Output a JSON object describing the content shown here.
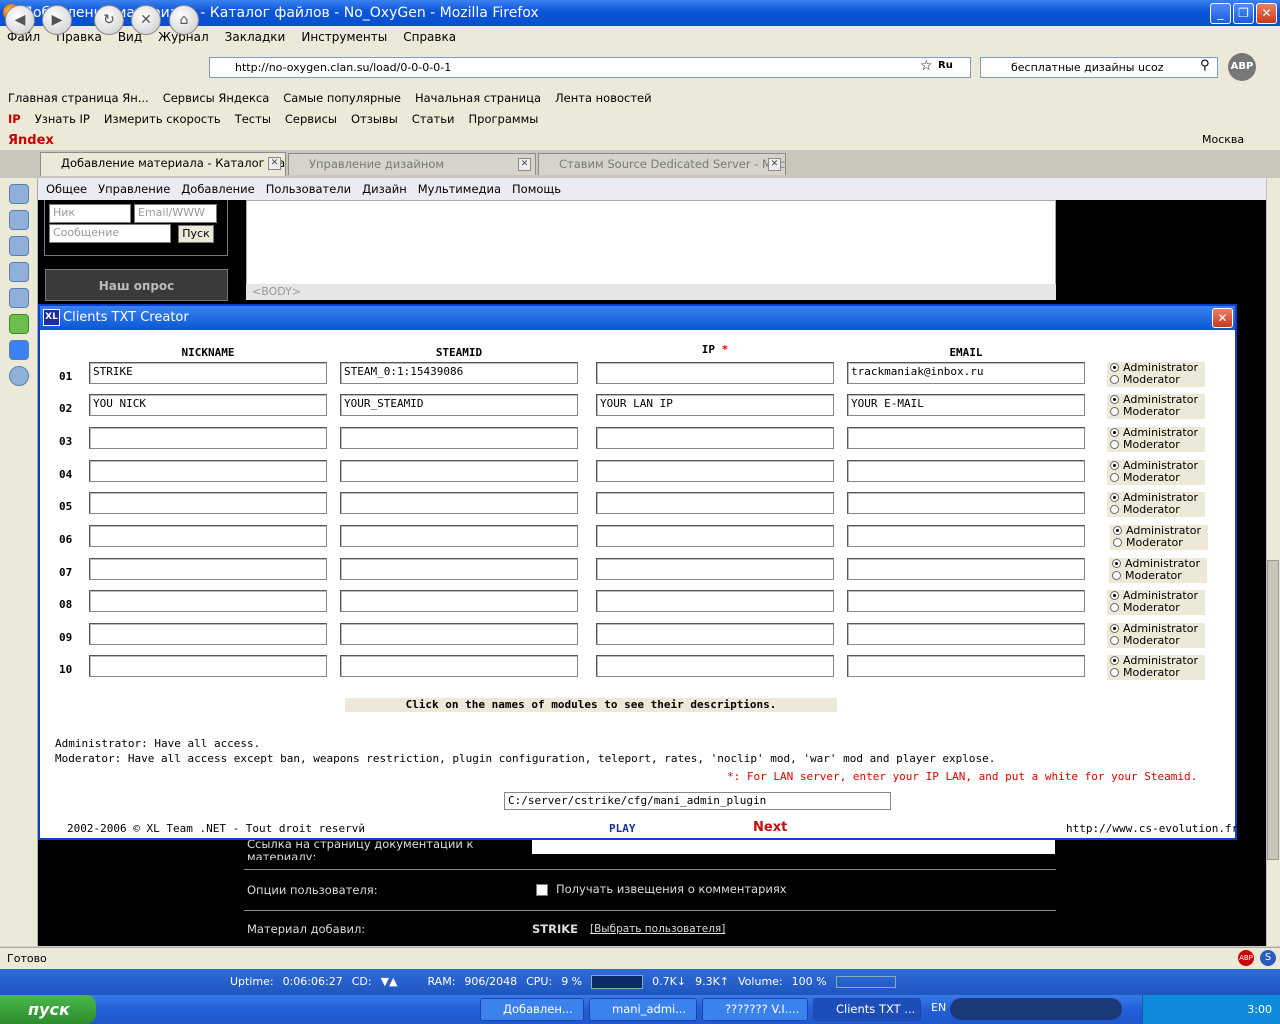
{
  "window": {
    "title": "Добавление материала - Каталог файлов - No_OxyGen - Mozilla Firefox"
  },
  "menu": [
    "Файл",
    "Правка",
    "Вид",
    "Журнал",
    "Закладки",
    "Инструменты",
    "Справка"
  ],
  "nav": {
    "url": "http://no-oxygen.clan.su/load/0-0-0-0-1",
    "search": "бесплатные дизайны ucoz",
    "lang_icon": "Ru"
  },
  "bookmarks": [
    "Главная страница Ян...",
    "Сервисы Яндекса",
    "Самые популярные",
    "Начальная страница",
    "Лента новостей"
  ],
  "ipbar": {
    "logo": "IP",
    "items": [
      "Узнать IP",
      "Измерить скорость",
      "Тесты",
      "Сервисы",
      "Отзывы",
      "Статьи",
      "Программы"
    ]
  },
  "yabar": {
    "logo": "Яndex",
    "city": "Москва"
  },
  "tabs": [
    {
      "label": "Добавление материала - Каталог фай..."
    },
    {
      "label": "Управление дизайном"
    },
    {
      "label": "Ставим Source Dedicated Server - Маст..."
    }
  ],
  "adminmenu": [
    "Общее",
    "Управление",
    "Добавление",
    "Пользователи",
    "Дизайн",
    "Мультимедиа",
    "Помощь"
  ],
  "chat": {
    "nick_ph": "Ник",
    "email_ph": "Email/WWW",
    "msg_ph": "Сообщение",
    "send": "Пуск",
    "poll": "Наш опрос"
  },
  "editor": {
    "body_tag": "<BODY>"
  },
  "page": {
    "doc_link_label": "Ссылка на страницу документации к материалу:",
    "user_options_label": "Опции пользователя:",
    "notify_label": "Получать извещения о комментариях",
    "added_by_label": "Материал добавил:",
    "added_by_user": "STRIKE",
    "choose_user": "[Выбрать пользователя]"
  },
  "dialog": {
    "title": "Clients TXT Creator",
    "headers": {
      "nickname": "NICKNAME",
      "steamid": "STEAMID",
      "ip": "IP",
      "ip_mark": "*",
      "email": "EMAIL"
    },
    "roles": {
      "admin": "Administrator",
      "mod": "Moderator"
    },
    "rows": [
      {
        "num": "01",
        "nick": "STRIKE",
        "steamid": "STEAM_0:1:15439086",
        "ip": "",
        "email": "trackmaniak@inbox.ru"
      },
      {
        "num": "02",
        "nick": "YOU NICK",
        "steamid": "YOUR_STEAMID",
        "ip": "YOUR LAN IP",
        "email": "YOUR E-MAIL"
      },
      {
        "num": "03",
        "nick": "",
        "steamid": "",
        "ip": "",
        "email": ""
      },
      {
        "num": "04",
        "nick": "",
        "steamid": "",
        "ip": "",
        "email": ""
      },
      {
        "num": "05",
        "nick": "",
        "steamid": "",
        "ip": "",
        "email": ""
      },
      {
        "num": "06",
        "nick": "",
        "steamid": "",
        "ip": "",
        "email": ""
      },
      {
        "num": "07",
        "nick": "",
        "steamid": "",
        "ip": "",
        "email": ""
      },
      {
        "num": "08",
        "nick": "",
        "steamid": "",
        "ip": "",
        "email": ""
      },
      {
        "num": "09",
        "nick": "",
        "steamid": "",
        "ip": "",
        "email": ""
      },
      {
        "num": "10",
        "nick": "",
        "steamid": "",
        "ip": "",
        "email": ""
      }
    ],
    "hint": "Click on the names of modules to see their descriptions.",
    "admin_desc": "Administrator: Have all access.",
    "mod_desc": "Moderator: Have all access except ban, weapons restriction, plugin configuration, teleport, rates, 'noclip' mod, 'war' mod and player explose.",
    "lan_note": "*: For LAN server, enter your IP LAN, and put a white for your Steamid.",
    "path": "C:/server/cstrike/cfg/mani_admin_plugin",
    "copyright": "2002-2006 © XL Team .NET - Tout droit reservй",
    "play": "PLAY",
    "next": "Next",
    "site": "http://www.cs-evolution.fr"
  },
  "status": {
    "text": "Готово"
  },
  "stats": [
    "Uptime:",
    "0:06:06:27",
    "CD:",
    "RAM:",
    "906/2048",
    "CPU:",
    "9 %",
    "0.7K↓",
    "9.3K↑",
    "Volume:",
    "100 %"
  ],
  "taskbar": {
    "start": "пуск",
    "tasks": [
      "Добавлен...",
      "mani_admi...",
      "??????? V.I....",
      "Clients TXT ..."
    ],
    "lang": "EN",
    "clock": "3:00"
  }
}
